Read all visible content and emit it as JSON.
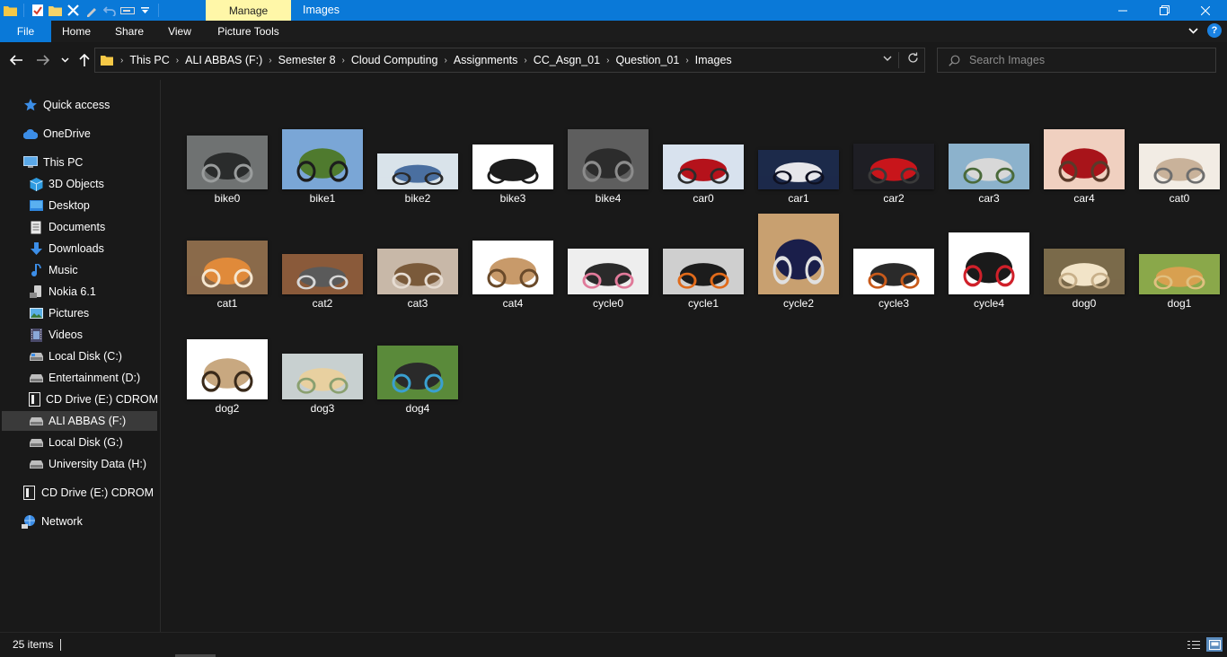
{
  "window": {
    "title": "Images",
    "manage_label": "Manage",
    "minimize_icon": "minimize-icon",
    "maximize_icon": "restore-icon",
    "close_icon": "close-icon"
  },
  "ribbon": {
    "tabs": [
      "File",
      "Home",
      "Share",
      "View",
      "Picture Tools"
    ]
  },
  "address": {
    "breadcrumbs": [
      "This PC",
      "ALI ABBAS (F:)",
      "Semester 8",
      "Cloud Computing",
      "Assignments",
      "CC_Asgn_01",
      "Question_01",
      "Images"
    ]
  },
  "search": {
    "placeholder": "Search Images"
  },
  "sidebar": {
    "items": [
      {
        "label": "Quick access",
        "icon": "star-icon"
      },
      {
        "label": "OneDrive",
        "icon": "cloud-icon"
      },
      {
        "label": "This PC",
        "icon": "computer-icon"
      },
      {
        "label": "3D Objects",
        "icon": "cube-icon"
      },
      {
        "label": "Desktop",
        "icon": "desktop-icon"
      },
      {
        "label": "Documents",
        "icon": "document-icon"
      },
      {
        "label": "Downloads",
        "icon": "download-icon"
      },
      {
        "label": "Music",
        "icon": "music-icon"
      },
      {
        "label": "Nokia 6.1",
        "icon": "phone-icon"
      },
      {
        "label": "Pictures",
        "icon": "pictures-icon"
      },
      {
        "label": "Videos",
        "icon": "video-icon"
      },
      {
        "label": "Local Disk (C:)",
        "icon": "drive-icon"
      },
      {
        "label": "Entertainment (D:)",
        "icon": "drive-icon"
      },
      {
        "label": "CD Drive (E:) CDROM",
        "icon": "cd-drive-icon"
      },
      {
        "label": "ALI ABBAS (F:)",
        "icon": "drive-icon",
        "selected": true
      },
      {
        "label": "Local Disk (G:)",
        "icon": "drive-icon"
      },
      {
        "label": "University Data (H:)",
        "icon": "drive-icon"
      },
      {
        "label": "CD Drive (E:) CDROM",
        "icon": "cd-drive-icon"
      },
      {
        "label": "Network",
        "icon": "network-icon"
      }
    ]
  },
  "files": [
    {
      "name": "bike0",
      "thumb_colors": [
        "#6f7272",
        "#2a2c2c",
        "#9a9d9d"
      ]
    },
    {
      "name": "bike1",
      "thumb_colors": [
        "#7aa6d6",
        "#4f7a2e",
        "#1d1d1d"
      ]
    },
    {
      "name": "bike2",
      "thumb_colors": [
        "#d9e3ea",
        "#4a6fa0",
        "#2a2a2a"
      ]
    },
    {
      "name": "bike3",
      "thumb_colors": [
        "#ffffff",
        "#1c1c1c",
        "#1c1c1c"
      ]
    },
    {
      "name": "bike4",
      "thumb_colors": [
        "#5e5e5e",
        "#2c2c2c",
        "#8c8c8c"
      ]
    },
    {
      "name": "car0",
      "thumb_colors": [
        "#d8e2ee",
        "#b5121b",
        "#2c2c2c"
      ]
    },
    {
      "name": "car1",
      "thumb_colors": [
        "#1c2a4a",
        "#e6e6ea",
        "#0e1020"
      ]
    },
    {
      "name": "car2",
      "thumb_colors": [
        "#1e1e24",
        "#c8151b",
        "#3a3a3a"
      ]
    },
    {
      "name": "car3",
      "thumb_colors": [
        "#8cb2cc",
        "#d8d8d8",
        "#4a6a3a"
      ]
    },
    {
      "name": "car4",
      "thumb_colors": [
        "#f0d0c0",
        "#a8141a",
        "#5a3a2a"
      ]
    },
    {
      "name": "cat0",
      "thumb_colors": [
        "#f2ece4",
        "#c9b29a",
        "#6e6e6e"
      ]
    },
    {
      "name": "cat1",
      "thumb_colors": [
        "#8a6a4a",
        "#e08a3a",
        "#f5e6d0"
      ]
    },
    {
      "name": "cat2",
      "thumb_colors": [
        "#8a5a3a",
        "#5a5a5a",
        "#d8d8d8"
      ]
    },
    {
      "name": "cat3",
      "thumb_colors": [
        "#c8b8a8",
        "#7a5a3a",
        "#e6dcd2"
      ]
    },
    {
      "name": "cat4",
      "thumb_colors": [
        "#ffffff",
        "#c89a6a",
        "#6a4a2a"
      ]
    },
    {
      "name": "cycle0",
      "thumb_colors": [
        "#eeeeee",
        "#2a2a2a",
        "#e07a9a"
      ]
    },
    {
      "name": "cycle1",
      "thumb_colors": [
        "#cfcfcf",
        "#1c1c1c",
        "#e06a1a"
      ]
    },
    {
      "name": "cycle2",
      "thumb_colors": [
        "#c8a070",
        "#1a1e4a",
        "#e0e0e0"
      ]
    },
    {
      "name": "cycle3",
      "thumb_colors": [
        "#ffffff",
        "#2a2a2a",
        "#c85a1a"
      ]
    },
    {
      "name": "cycle4",
      "thumb_colors": [
        "#ffffff",
        "#1a1a1a",
        "#d0202a"
      ]
    },
    {
      "name": "dog0",
      "thumb_colors": [
        "#7a6a4a",
        "#f2e4c8",
        "#c8b08a"
      ]
    },
    {
      "name": "dog1",
      "thumb_colors": [
        "#8aa84a",
        "#d8a050",
        "#e0c080"
      ]
    },
    {
      "name": "dog2",
      "thumb_colors": [
        "#ffffff",
        "#c8a880",
        "#3a2a1a"
      ]
    },
    {
      "name": "dog3",
      "thumb_colors": [
        "#c8d0d0",
        "#e8d0a0",
        "#8aa070"
      ]
    },
    {
      "name": "dog4",
      "thumb_colors": [
        "#5a8a3a",
        "#2a2a2a",
        "#3aa0d0"
      ]
    }
  ],
  "status": {
    "item_count": "25 items"
  }
}
